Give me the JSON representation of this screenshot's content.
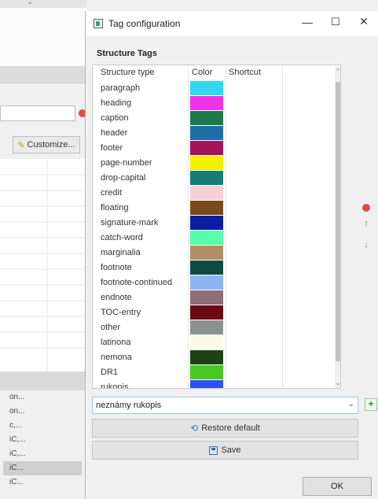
{
  "background_window": {
    "customize_label": "Customize...",
    "list_items": [
      "on...",
      "on...",
      "c,...",
      "iC,...",
      "iC,...",
      "iC...",
      "iC..."
    ]
  },
  "dialog": {
    "title": "Tag configuration",
    "window_controls": {
      "minimize": "—",
      "maximize": "☐",
      "close": "✕"
    },
    "section_title": "Structure Tags",
    "table": {
      "headers": {
        "type": "Structure type",
        "color": "Color",
        "shortcut": "Shortcut"
      },
      "rows": [
        {
          "name": "paragraph",
          "color": "#33d6f0"
        },
        {
          "name": "heading",
          "color": "#ee33e6"
        },
        {
          "name": "caption",
          "color": "#1a7a4e"
        },
        {
          "name": "header",
          "color": "#1d6fa8"
        },
        {
          "name": "footer",
          "color": "#a3125a"
        },
        {
          "name": "page-number",
          "color": "#f5f000"
        },
        {
          "name": "drop-capital",
          "color": "#147d77"
        },
        {
          "name": "credit",
          "color": "#f7cfd9"
        },
        {
          "name": "floating",
          "color": "#7a4a1c"
        },
        {
          "name": "signature-mark",
          "color": "#0b1ea0"
        },
        {
          "name": "catch-word",
          "color": "#55ffaa"
        },
        {
          "name": "marginalia",
          "color": "#b28e66"
        },
        {
          "name": "footnote",
          "color": "#0e4b41"
        },
        {
          "name": "footnote-continued",
          "color": "#8fb3f2"
        },
        {
          "name": "endnote",
          "color": "#8e6e78"
        },
        {
          "name": "TOC-entry",
          "color": "#6a0a12"
        },
        {
          "name": "other",
          "color": "#8a9290"
        },
        {
          "name": "latinona",
          "color": "#fdfbe5"
        },
        {
          "name": "nemona",
          "color": "#1d4216"
        },
        {
          "name": "DR1",
          "color": "#46c820"
        },
        {
          "name": "rukopis",
          "color": "#2e52f0"
        }
      ]
    },
    "combo": {
      "value": "neznámy rukopis"
    },
    "restore_label": "Restore default",
    "save_label": "Save",
    "ok_label": "OK"
  },
  "icons": {
    "side_delete": "red-dot-icon",
    "side_up": "green-arrow-up-icon",
    "side_down": "green-arrow-down-icon",
    "add": "green-plus-icon"
  }
}
